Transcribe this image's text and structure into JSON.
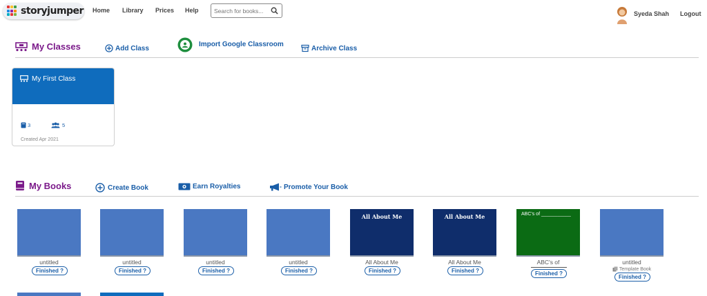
{
  "topnav": {
    "logo_text": "storyjumper",
    "links": [
      "Home",
      "Library",
      "Prices",
      "Help"
    ],
    "search_placeholder": "Search for books...",
    "user_name": "Syeda Shah",
    "logout": "Logout"
  },
  "classes": {
    "title": "My Classes",
    "add_class": "Add Class",
    "import_google": "Import Google Classroom",
    "archive_class": "Archive Class",
    "card": {
      "name": "My First Class",
      "books_count": "3",
      "students_count": "5",
      "created": "Created Apr 2021"
    }
  },
  "books": {
    "title": "My Books",
    "create_book": "Create Book",
    "earn_royalties": "Earn Royalties",
    "promote": "Promote Your Book",
    "finished_label": "Finished ?",
    "items": [
      {
        "title": "untitled",
        "cover_color": "#4a78c2",
        "cover_text": ""
      },
      {
        "title": "untitled",
        "cover_color": "#4a78c2",
        "cover_text": ""
      },
      {
        "title": "untitled",
        "cover_color": "#4a78c2",
        "cover_text": ""
      },
      {
        "title": "untitled",
        "cover_color": "#4a78c2",
        "cover_text": ""
      },
      {
        "title": "All About Me",
        "cover_color": "#0f2d6b",
        "cover_text": "All About Me"
      },
      {
        "title": "All About Me",
        "cover_color": "#0f2d6b",
        "cover_text": "All About Me"
      },
      {
        "title": "ABC's of",
        "cover_color": "#0b6b14",
        "cover_text": "ABC's of ___________"
      },
      {
        "title": "untitled",
        "cover_color": "#4a78c2",
        "cover_text": "",
        "template_label": "Template Book"
      }
    ]
  },
  "colors": {
    "accent_purple": "#7b1a8a",
    "link_blue": "#1a5ea8",
    "card_blue": "#0f6cbd"
  }
}
